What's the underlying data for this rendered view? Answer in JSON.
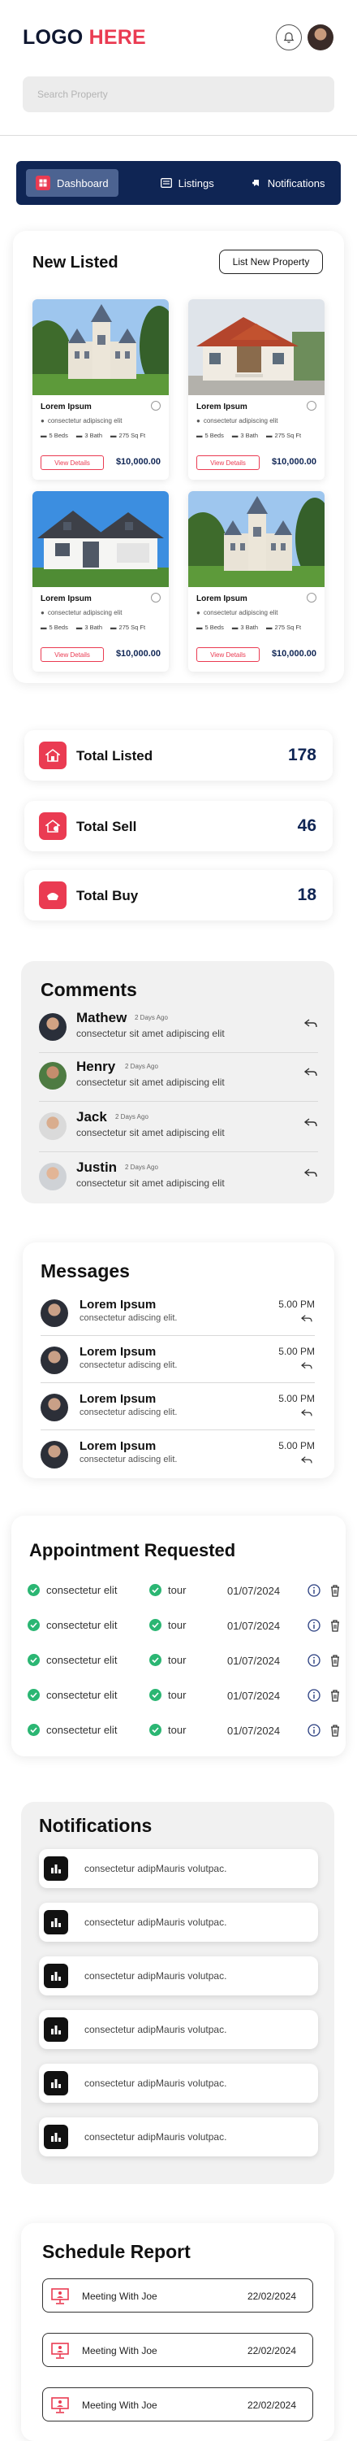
{
  "header": {
    "logo_main": "LOGO",
    "logo_accent": " HERE",
    "search_placeholder": "Search Property"
  },
  "tabs": [
    {
      "label": "Dashboard",
      "icon": "dashboard-icon",
      "active": true
    },
    {
      "label": "Listings",
      "icon": "listings-icon",
      "active": false
    },
    {
      "label": "Notifications",
      "icon": "notifications-icon",
      "active": false
    }
  ],
  "new_listed": {
    "title": "New Listed",
    "button": "List New Property",
    "properties": [
      {
        "name": "Lorem Ipsum",
        "location": "consectetur adipiscing elit",
        "beds": "5 Beds",
        "bath": "3 Bath",
        "area": "275 Sq Ft",
        "view": "View Details",
        "price": "$10,000.00",
        "image": "castle"
      },
      {
        "name": "Lorem Ipsum",
        "location": "consectetur adipiscing elit",
        "beds": "5 Beds",
        "bath": "3 Bath",
        "area": "275 Sq Ft",
        "view": "View Details",
        "price": "$10,000.00",
        "image": "brick-house"
      },
      {
        "name": "Lorem Ipsum",
        "location": "consectetur adipiscing elit",
        "beds": "5 Beds",
        "bath": "3 Bath",
        "area": "275 Sq Ft",
        "view": "View Details",
        "price": "$10,000.00",
        "image": "white-house"
      },
      {
        "name": "Lorem Ipsum",
        "location": "consectetur adipiscing elit",
        "beds": "5 Beds",
        "bath": "3 Bath",
        "area": "275 Sq Ft",
        "view": "View Details",
        "price": "$10,000.00",
        "image": "castle"
      }
    ]
  },
  "stats": [
    {
      "label": "Total Listed",
      "value": "178",
      "icon": "house-icon"
    },
    {
      "label": "Total Sell",
      "value": "46",
      "icon": "sell-icon"
    },
    {
      "label": "Total Buy",
      "value": "18",
      "icon": "buy-icon"
    }
  ],
  "comments": {
    "title": "Comments",
    "items": [
      {
        "name": "Mathew",
        "time": "2 Days Ago",
        "text": "consectetur sit amet adipiscing elit"
      },
      {
        "name": "Henry",
        "time": "2 Days Ago",
        "text": "consectetur sit amet adipiscing elit"
      },
      {
        "name": "Jack",
        "time": "2 Days Ago",
        "text": "consectetur sit amet adipiscing elit"
      },
      {
        "name": "Justin",
        "time": "2 Days Ago",
        "text": "consectetur sit amet adipiscing elit"
      }
    ]
  },
  "messages": {
    "title": "Messages",
    "items": [
      {
        "name": "Lorem Ipsum",
        "text": "consectetur adiscing elit.",
        "time": "5.00 PM"
      },
      {
        "name": "Lorem Ipsum",
        "text": "consectetur adiscing elit.",
        "time": "5.00 PM"
      },
      {
        "name": "Lorem Ipsum",
        "text": "consectetur adiscing elit.",
        "time": "5.00 PM"
      },
      {
        "name": "Lorem Ipsum",
        "text": "consectetur adiscing elit.",
        "time": "5.00 PM"
      }
    ]
  },
  "appointments": {
    "title": "Appointment Requested",
    "rows": [
      {
        "name": "consectetur elit",
        "type": "tour",
        "date": "01/07/2024"
      },
      {
        "name": "consectetur elit",
        "type": "tour",
        "date": "01/07/2024"
      },
      {
        "name": "consectetur elit",
        "type": "tour",
        "date": "01/07/2024"
      },
      {
        "name": "consectetur elit",
        "type": "tour",
        "date": "01/07/2024"
      },
      {
        "name": "consectetur elit",
        "type": "tour",
        "date": "01/07/2024"
      }
    ]
  },
  "notifications": {
    "title": "Notifications",
    "items": [
      {
        "text": "consectetur adipMauris volutpac."
      },
      {
        "text": "consectetur adipMauris volutpac."
      },
      {
        "text": "consectetur adipMauris volutpac."
      },
      {
        "text": "consectetur adipMauris volutpac."
      },
      {
        "text": "consectetur adipMauris volutpac."
      },
      {
        "text": "consectetur adipMauris volutpac."
      }
    ]
  },
  "schedule": {
    "title": "Schedule Report",
    "items": [
      {
        "text": "Meeting With Joe",
        "date": "22/02/2024"
      },
      {
        "text": "Meeting With Joe",
        "date": "22/02/2024"
      },
      {
        "text": "Meeting With Joe",
        "date": "22/02/2024"
      }
    ]
  },
  "colors": {
    "accent": "#ea3b52",
    "navy": "#0f2554",
    "success": "#2bb673"
  }
}
